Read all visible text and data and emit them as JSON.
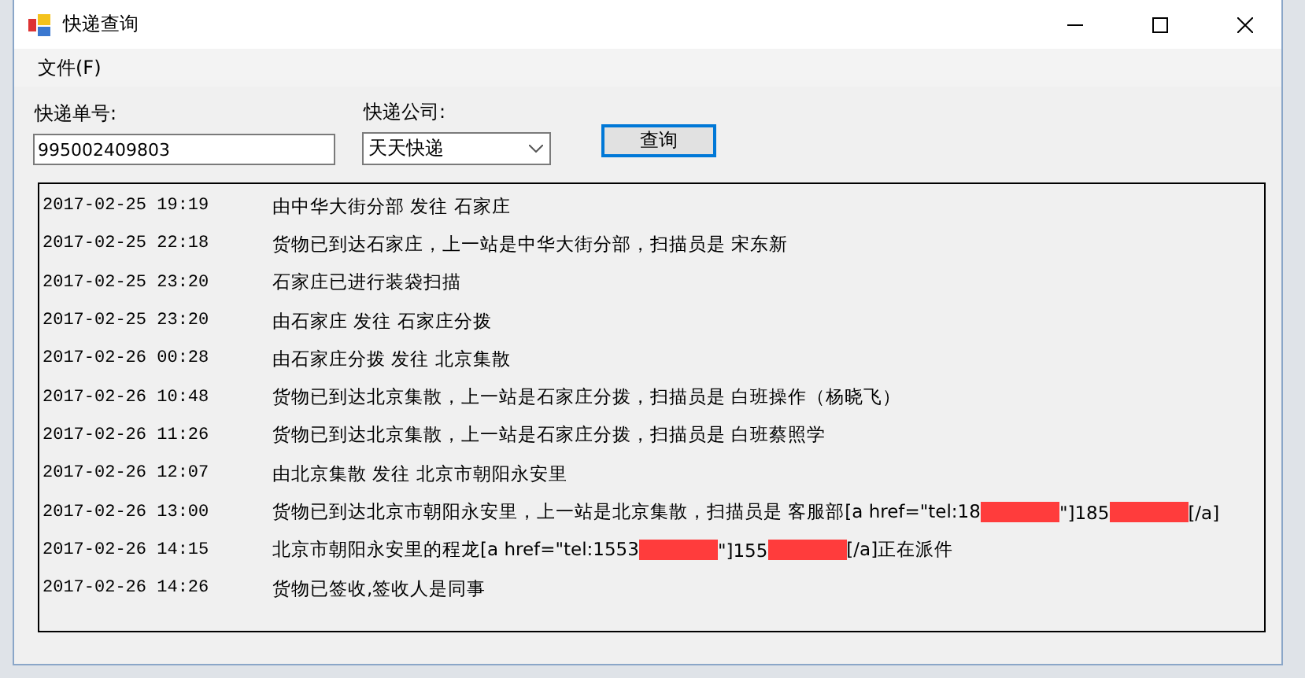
{
  "window": {
    "title": "快递查询"
  },
  "menu": [
    {
      "label": "文件(F)"
    }
  ],
  "form": {
    "tracking_label": "快递单号:",
    "tracking_value": "995002409803",
    "company_label": "快递公司:",
    "company_value": "天天快递",
    "query_button": "查询"
  },
  "records": [
    {
      "time": "2017-02-25 19:19",
      "parts": [
        {
          "kind": "text",
          "text": "由中华大街分部 发往 石家庄"
        }
      ]
    },
    {
      "time": "2017-02-25 22:18",
      "parts": [
        {
          "kind": "text",
          "text": "货物已到达石家庄，上一站是中华大街分部，扫描员是 宋东新"
        }
      ]
    },
    {
      "time": "2017-02-25 23:20",
      "parts": [
        {
          "kind": "text",
          "text": "石家庄已进行装袋扫描"
        }
      ]
    },
    {
      "time": "2017-02-25 23:20",
      "parts": [
        {
          "kind": "text",
          "text": "由石家庄 发往 石家庄分拨"
        }
      ]
    },
    {
      "time": "2017-02-26 00:28",
      "parts": [
        {
          "kind": "text",
          "text": "由石家庄分拨 发往 北京集散"
        }
      ]
    },
    {
      "time": "2017-02-26 10:48",
      "parts": [
        {
          "kind": "text",
          "text": "货物已到达北京集散，上一站是石家庄分拨，扫描员是 白班操作（杨晓飞）"
        }
      ]
    },
    {
      "time": "2017-02-26 11:26",
      "parts": [
        {
          "kind": "text",
          "text": "货物已到达北京集散，上一站是石家庄分拨，扫描员是 白班蔡照学"
        }
      ]
    },
    {
      "time": "2017-02-26 12:07",
      "parts": [
        {
          "kind": "text",
          "text": "由北京集散 发往 北京市朝阳永安里"
        }
      ]
    },
    {
      "time": "2017-02-26 13:00",
      "parts": [
        {
          "kind": "text",
          "text": "货物已到达北京市朝阳永安里，上一站是北京集散，扫描员是 客服部[a href=\"tel:18"
        },
        {
          "kind": "redacted"
        },
        {
          "kind": "text",
          "text": "\"]185"
        },
        {
          "kind": "redacted"
        },
        {
          "kind": "text",
          "text": "[/a]"
        }
      ]
    },
    {
      "time": "2017-02-26 14:15",
      "parts": [
        {
          "kind": "text",
          "text": "北京市朝阳永安里的程龙[a href=\"tel:1553"
        },
        {
          "kind": "redacted"
        },
        {
          "kind": "text",
          "text": "\"]155"
        },
        {
          "kind": "redacted"
        },
        {
          "kind": "text",
          "text": "[/a]正在派件"
        }
      ]
    },
    {
      "time": "2017-02-26 14:26",
      "parts": [
        {
          "kind": "text",
          "text": "货物已签收,签收人是同事"
        }
      ]
    }
  ]
}
